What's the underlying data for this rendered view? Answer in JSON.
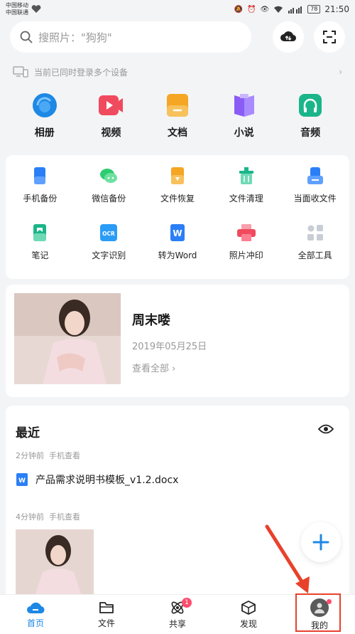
{
  "status": {
    "carrier1": "中国移动",
    "carrier2": "中国联通",
    "battery": "78",
    "time": "21:50"
  },
  "search": {
    "placeholder": "搜照片：\"狗狗\""
  },
  "device_notice": "当前已同时登录多个设备",
  "categories": [
    {
      "label": "相册",
      "color": "#1e88e5"
    },
    {
      "label": "视频",
      "color": "#f04a5e"
    },
    {
      "label": "文档",
      "color": "#f5a623"
    },
    {
      "label": "小说",
      "color": "#8a5cf6"
    },
    {
      "label": "音频",
      "color": "#1bb58a"
    }
  ],
  "tools": [
    {
      "label": "手机备份",
      "color": "#2b7ff6"
    },
    {
      "label": "微信备份",
      "color": "#2ecc71"
    },
    {
      "label": "文件恢复",
      "color": "#f5a623"
    },
    {
      "label": "文件清理",
      "color": "#1bb58a"
    },
    {
      "label": "当面收文件",
      "color": "#2b7ff6"
    },
    {
      "label": "笔记",
      "color": "#1bb58a"
    },
    {
      "label": "文字识别",
      "color": "#2b9cf6",
      "icon_text": "OCR"
    },
    {
      "label": "转为Word",
      "color": "#2b7ff6",
      "icon_text": "W"
    },
    {
      "label": "照片冲印",
      "color": "#f04a5e"
    },
    {
      "label": "全部工具",
      "color": "#c9cdd4"
    }
  ],
  "memory": {
    "title": "周末喽",
    "date": "2019年05月25日",
    "link": "查看全部"
  },
  "recent": {
    "title": "最近",
    "group1_time": "2分钟前",
    "group1_source": "手机查看",
    "file_name": "产品需求说明书模板_v1.2.docx",
    "group2_time": "4分钟前",
    "group2_source": "手机查看"
  },
  "tabbar": [
    {
      "label": "首页",
      "active": true
    },
    {
      "label": "文件"
    },
    {
      "label": "共享",
      "badge": "1"
    },
    {
      "label": "发现"
    },
    {
      "label": "我的"
    }
  ],
  "colors": {
    "accent": "#1e88e5",
    "annotation": "#e8412c"
  }
}
